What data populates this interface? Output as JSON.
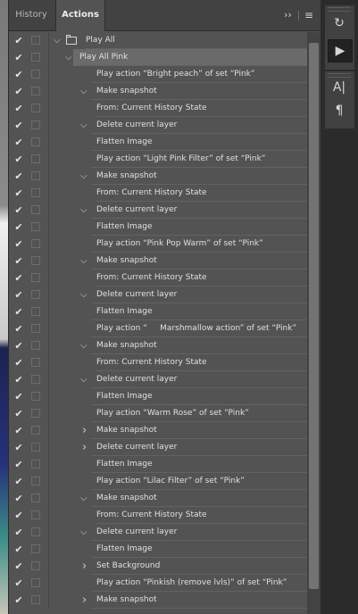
{
  "tabs": {
    "history": "History",
    "actions": "Actions"
  },
  "controls": {
    "collapse": "››",
    "menu": "≡"
  },
  "rows": [
    {
      "text": "Play All",
      "level": 0,
      "tw": "open",
      "folder": true,
      "sel": false
    },
    {
      "text": "Play All Pink",
      "level": 1,
      "tw": "open",
      "folder": false,
      "sel": true
    },
    {
      "text": "Play action “Bright peach” of set “Pink”",
      "level": 2,
      "tw": "",
      "sel": false
    },
    {
      "text": "Make snapshot",
      "level": 2,
      "tw": "open",
      "sel": false
    },
    {
      "text": "From: Current History State",
      "level": 3,
      "tw": "",
      "sel": false
    },
    {
      "text": "Delete current layer",
      "level": 2,
      "tw": "open",
      "sel": false
    },
    {
      "text": "Flatten Image",
      "level": 2,
      "tw": "",
      "sel": false
    },
    {
      "text": "Play action “Light Pink Filter” of set “Pink”",
      "level": 2,
      "tw": "",
      "sel": false
    },
    {
      "text": "Make snapshot",
      "level": 2,
      "tw": "open",
      "sel": false
    },
    {
      "text": "From: Current History State",
      "level": 3,
      "tw": "",
      "sel": false
    },
    {
      "text": "Delete current layer",
      "level": 2,
      "tw": "open",
      "sel": false
    },
    {
      "text": "Flatten Image",
      "level": 2,
      "tw": "",
      "sel": false
    },
    {
      "text": "Play action “Pink Pop Warm” of set “Pink”",
      "level": 2,
      "tw": "",
      "sel": false
    },
    {
      "text": "Make snapshot",
      "level": 2,
      "tw": "open",
      "sel": false
    },
    {
      "text": "From: Current History State",
      "level": 3,
      "tw": "",
      "sel": false
    },
    {
      "text": "Delete current layer",
      "level": 2,
      "tw": "open",
      "sel": false
    },
    {
      "text": "Flatten Image",
      "level": 2,
      "tw": "",
      "sel": false
    },
    {
      "text": "Play action “     Marshmallow action” of set “Pink”",
      "level": 2,
      "tw": "",
      "sel": false
    },
    {
      "text": "Make snapshot",
      "level": 2,
      "tw": "open",
      "sel": false
    },
    {
      "text": "From: Current History State",
      "level": 3,
      "tw": "",
      "sel": false
    },
    {
      "text": "Delete current layer",
      "level": 2,
      "tw": "open",
      "sel": false
    },
    {
      "text": "Flatten Image",
      "level": 2,
      "tw": "",
      "sel": false
    },
    {
      "text": "Play action “Warm Rose” of set “Pink”",
      "level": 2,
      "tw": "",
      "sel": false
    },
    {
      "text": "Make snapshot",
      "level": 2,
      "tw": "closed",
      "sel": false
    },
    {
      "text": "Delete current layer",
      "level": 2,
      "tw": "closed",
      "sel": false
    },
    {
      "text": "Flatten Image",
      "level": 2,
      "tw": "",
      "sel": false
    },
    {
      "text": "Play action “Lilac Filter” of set “Pink”",
      "level": 2,
      "tw": "",
      "sel": false
    },
    {
      "text": "Make snapshot",
      "level": 2,
      "tw": "open",
      "sel": false
    },
    {
      "text": "From: Current History State",
      "level": 3,
      "tw": "",
      "sel": false
    },
    {
      "text": "Delete current layer",
      "level": 2,
      "tw": "open",
      "sel": false
    },
    {
      "text": "Flatten Image",
      "level": 2,
      "tw": "",
      "sel": false
    },
    {
      "text": "Set Background",
      "level": 2,
      "tw": "closed",
      "sel": false
    },
    {
      "text": "Play action “Pinkish (remove lvls)” of set “Pink”",
      "level": 2,
      "tw": "",
      "sel": false
    },
    {
      "text": "Make snapshot",
      "level": 2,
      "tw": "closed",
      "sel": false
    }
  ],
  "toolbar": [
    {
      "icon": "history-brush-icon",
      "glyph": "↻"
    },
    {
      "icon": "actions-play-icon",
      "glyph": "▶"
    },
    {
      "icon": "character-panel-icon",
      "glyph": "A|"
    },
    {
      "icon": "paragraph-panel-icon",
      "glyph": "¶"
    }
  ],
  "check_glyph": "✔"
}
